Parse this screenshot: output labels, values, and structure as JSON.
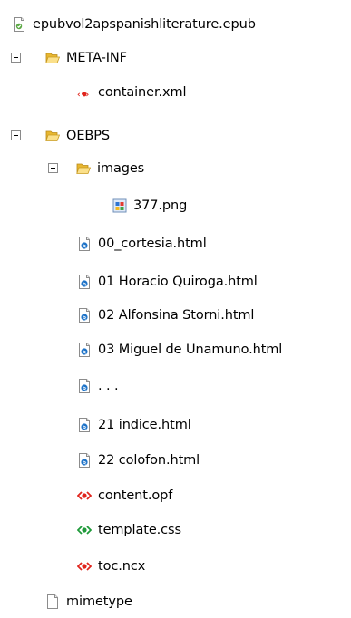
{
  "tree": {
    "root": {
      "label": "epubvol2apspanishliterature.epub",
      "icon": "epub-file-icon"
    },
    "meta_inf": {
      "label": "META-INF",
      "icon": "folder-open-icon",
      "expanded": true
    },
    "container_xml": {
      "label": "container.xml",
      "icon": "xml-file-icon"
    },
    "oebps": {
      "label": "OEBPS",
      "icon": "folder-open-icon",
      "expanded": true
    },
    "images": {
      "label": "images",
      "icon": "folder-open-icon",
      "expanded": true
    },
    "png377": {
      "label": "377.png",
      "icon": "image-file-icon"
    },
    "f00": {
      "label": "00_cortesia.html",
      "icon": "html-file-icon"
    },
    "f01": {
      "label": "01 Horacio Quiroga.html",
      "icon": "html-file-icon"
    },
    "f02": {
      "label": "02 Alfonsina Storni.html",
      "icon": "html-file-icon"
    },
    "f03": {
      "label": "03 Miguel de Unamuno.html",
      "icon": "html-file-icon"
    },
    "ellipsis": {
      "label": ". . .",
      "icon": "html-file-icon"
    },
    "f21": {
      "label": "21 indice.html",
      "icon": "html-file-icon"
    },
    "f22": {
      "label": "22 colofon.html",
      "icon": "html-file-icon"
    },
    "content_opf": {
      "label": "content.opf",
      "icon": "xml-file-icon"
    },
    "template_css": {
      "label": "template.css",
      "icon": "css-file-icon"
    },
    "toc_ncx": {
      "label": "toc.ncx",
      "icon": "xml-file-icon"
    },
    "mimetype": {
      "label": "mimetype",
      "icon": "blank-file-icon"
    }
  },
  "colors": {
    "folder": "#f5cf4e",
    "html_globe": "#1e73c8",
    "xml_red": "#e0241c",
    "css_green": "#1f9a3a",
    "epub_green": "#5aa843"
  }
}
